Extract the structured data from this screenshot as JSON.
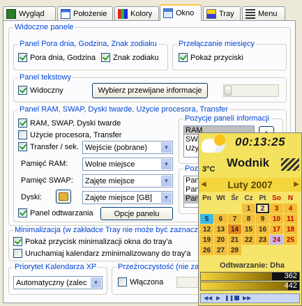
{
  "tabs": [
    {
      "label": "Wygląd",
      "icon": "palette-icon"
    },
    {
      "label": "Położenie",
      "icon": "window-position-icon"
    },
    {
      "label": "Kolory",
      "icon": "colors-icon"
    },
    {
      "label": "Okno",
      "icon": "window-icon",
      "active": true
    },
    {
      "label": "Tray",
      "icon": "tray-icon"
    },
    {
      "label": "Menu",
      "icon": "menu-icon"
    }
  ],
  "visible_panels": {
    "title": "Widoczne panele",
    "daytime": {
      "title": "Panel Pora dnia, Godzina, Znak zodiaku",
      "opt1": "Pora dnia, Godzina",
      "opt2": "Znak zodiaku"
    },
    "months": {
      "title": "Przełączanie miesięcy",
      "opt1": "Pokaż przyciski"
    },
    "text": {
      "title": "Panel tekstowy",
      "opt1": "Widoczny",
      "button": "Wybierz przewijane informacje"
    },
    "ram": {
      "title": "Panel RAM, SWAP, Dyski twarde, Użycie procesora, Transfer",
      "opt1": "RAM, SWAP, Dyski twarde",
      "opt2": "Użycie procesora, Transfer",
      "opt3": "Transfer / sek.",
      "transfer_value": "Wejście (pobrane)",
      "ram_label": "Pamięć RAM:",
      "ram_value": "Wolne miejsce",
      "swap_label": "Pamięć SWAP:",
      "swap_value": "Zajęte miejsce",
      "disks_label": "Dyski:",
      "disks_value": "Zajęte miejsce [GB]",
      "playback": "Panel odtwarzania",
      "options_button": "Opcje panelu",
      "positions_title": "Pozycje paneli informacji",
      "positions": [
        "RAM",
        "SWA",
        "Uży"
      ],
      "positions2_title": "Pozy",
      "positions2": [
        "Pan",
        "Pan",
        "Pan"
      ]
    }
  },
  "minimize": {
    "title": "Minimalizacja (w zakładce Tray nie może być zaznaczo",
    "opt1": "Pokaż przycisk minimalizacji okna do tray'a",
    "opt2": "Uruchamiaj kalendarz zminimalizowany do tray'a"
  },
  "priority": {
    "title": "Priorytet Kalendarza XP",
    "value": "Automatyczny (zalec"
  },
  "transparency": {
    "title": "Przeźroczystość (nie zale",
    "opt1": "Włączona"
  },
  "widget": {
    "time": "00:13:25",
    "temperature": "3°C",
    "zodiac": "Wodnik",
    "month": "Luty 2007",
    "day_headers": [
      "Pn",
      "Wt",
      "Śr",
      "Cz",
      "Pt",
      "So",
      "N"
    ],
    "days": [
      [
        "",
        "",
        "",
        "1",
        "2",
        "3",
        "4"
      ],
      [
        "5",
        "6",
        "7",
        "8",
        "9",
        "10",
        "11"
      ],
      [
        "12",
        "13",
        "14",
        "15",
        "16",
        "17",
        "18"
      ],
      [
        "19",
        "20",
        "21",
        "22",
        "23",
        "24",
        "25"
      ],
      [
        "26",
        "27",
        "28",
        "",
        "",
        "",
        ""
      ]
    ],
    "playing": "Odtwarzanie: Dha",
    "bar1_value": "362",
    "bar2_value": "442"
  },
  "colors": {
    "accent": "#0046d5",
    "tab_highlight": "#ffc83c",
    "widget_bg": "#f7e46a",
    "check": "#21a121"
  }
}
